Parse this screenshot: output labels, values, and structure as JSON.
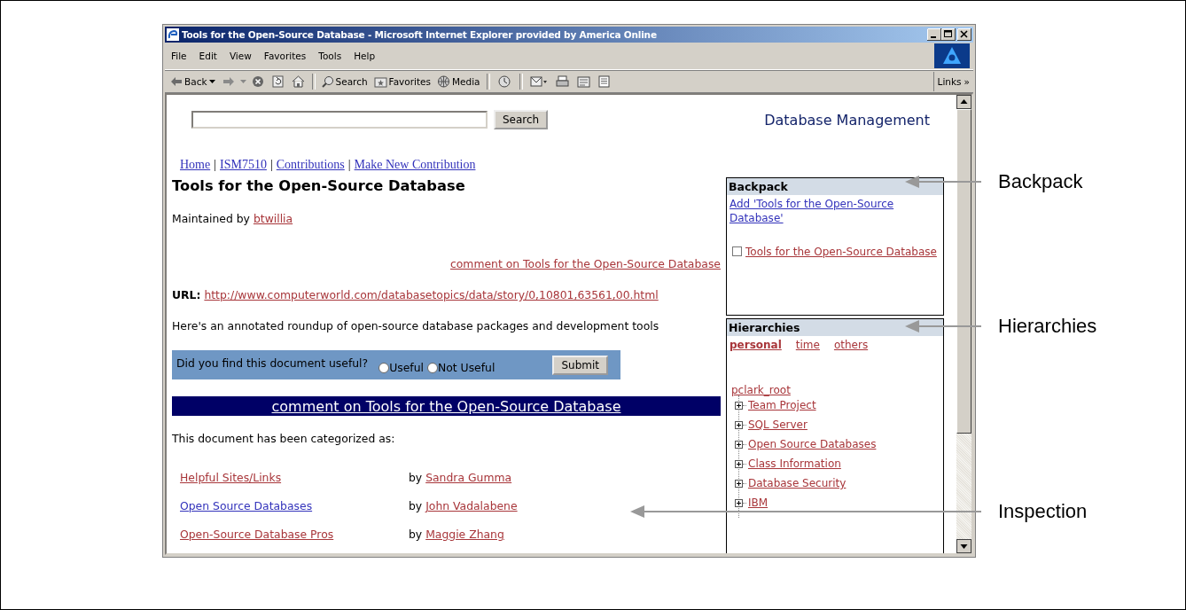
{
  "window": {
    "title": "Tools for the Open-Source Database - Microsoft Internet Explorer provided by America Online"
  },
  "menu": [
    "File",
    "Edit",
    "View",
    "Favorites",
    "Tools",
    "Help"
  ],
  "toolbar": [
    {
      "kind": "back",
      "label": "Back"
    },
    {
      "kind": "forward"
    },
    {
      "kind": "stop"
    },
    {
      "kind": "refresh"
    },
    {
      "kind": "home"
    },
    {
      "kind": "search",
      "label": "Search"
    },
    {
      "kind": "favorites",
      "label": "Favorites"
    },
    {
      "kind": "media",
      "label": "Media"
    },
    {
      "kind": "history"
    },
    {
      "kind": "mail"
    },
    {
      "kind": "print"
    },
    {
      "kind": "edit"
    },
    {
      "kind": "discuss"
    }
  ],
  "links": {
    "label": "Links",
    "chevron": "»"
  },
  "page": {
    "search_button": "Search",
    "site_title": "Database Management",
    "nav": [
      {
        "kind": "link",
        "label": "Home"
      },
      {
        "kind": "separator",
        "label": "|"
      },
      {
        "kind": "link",
        "label": "ISM7510"
      },
      {
        "kind": "separator",
        "label": "|"
      },
      {
        "kind": "link",
        "label": "Contributions"
      },
      {
        "kind": "separator",
        "label": "|"
      },
      {
        "kind": "link",
        "label": "Make New Contribution"
      }
    ],
    "heading": "Tools for the Open-Source Database",
    "maintained": {
      "label": "Maintained by",
      "user": "btwillia"
    },
    "comment_link": "comment on Tools for the Open-Source Database",
    "url": {
      "label": "URL:",
      "link": "http://www.computerworld.com/databasetopics/data/story/0,10801,63561,00.html"
    },
    "description": "Here's an annotated roundup of open-source database packages and development tools",
    "feedback": {
      "question": "Did you find this document useful?",
      "options": [
        {
          "label": "Useful",
          "selected": false
        },
        {
          "label": "Not Useful",
          "selected": false
        }
      ],
      "button": "Submit"
    },
    "comment_banner": "comment on Tools for the Open-Source Database",
    "categorized_label": "This document has been categorized as:",
    "categories": [
      {
        "name": "Helpful Sites/Links",
        "visited": true,
        "by": "by",
        "author": "Sandra Gumma"
      },
      {
        "name": "Open Source Databases",
        "visited": false,
        "by": "by",
        "author": "John Vadalabene"
      },
      {
        "name": "Open-Source Database Pros",
        "visited": true,
        "by": "by",
        "author": "Maggie Zhang"
      }
    ]
  },
  "backpack": {
    "title": "Backpack",
    "add_link": "Add 'Tools for the Open-Source Database'",
    "items": [
      {
        "label": "Tools for the Open-Source Database",
        "checked": false
      }
    ]
  },
  "hierarchies": {
    "title": "Hierarchies",
    "tabs": [
      {
        "label": "personal",
        "selected": true
      },
      {
        "label": "time",
        "selected": false
      },
      {
        "label": "others",
        "selected": false
      }
    ],
    "root": "pclark_root",
    "children": [
      {
        "label": "Team Project",
        "expanded": false
      },
      {
        "label": "SQL Server",
        "expanded": false
      },
      {
        "label": "Open Source Databases",
        "expanded": false
      },
      {
        "label": "Class Information",
        "expanded": false
      },
      {
        "label": "Database Security",
        "expanded": false
      },
      {
        "label": "IBM",
        "expanded": false
      }
    ]
  },
  "callouts": [
    {
      "label": "Backpack"
    },
    {
      "label": "Hierarchies"
    },
    {
      "label": "Inspection"
    }
  ]
}
